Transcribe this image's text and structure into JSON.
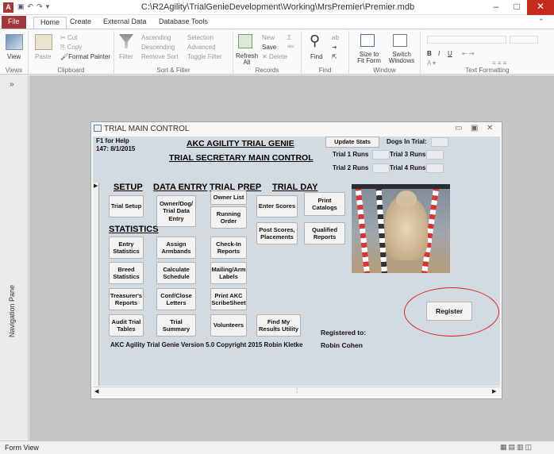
{
  "window": {
    "title": "C:\\R2Agility\\TrialGenieDevelopment\\Working\\MrsPremier\\Premier.mdb",
    "app_icon": "A"
  },
  "tabs": [
    "File",
    "Home",
    "Create",
    "External Data",
    "Database Tools"
  ],
  "ribbon": {
    "views": {
      "label": "View",
      "group": "Views"
    },
    "clipboard": {
      "paste": "Paste",
      "cut": "Cut",
      "copy": "Copy",
      "format_painter": "Format Painter",
      "group": "Clipboard"
    },
    "sort_filter": {
      "filter": "Filter",
      "ascending": "Ascending",
      "descending": "Descending",
      "remove_sort": "Remove Sort",
      "selection": "Selection",
      "advanced": "Advanced",
      "toggle_filter": "Toggle Filter",
      "group": "Sort & Filter"
    },
    "records": {
      "refresh": "Refresh All",
      "new": "New",
      "save": "Save",
      "delete": "Delete",
      "group": "Records"
    },
    "find": {
      "find": "Find",
      "group": "Find"
    },
    "window": {
      "size_to_fit": "Size to Fit Form",
      "switch_windows": "Switch Windows",
      "group": "Window"
    },
    "text_formatting": {
      "group": "Text Formatting"
    }
  },
  "nav_pane": "Navigation Pane",
  "status": "Form View",
  "form": {
    "title": "TRIAL MAIN CONTROL",
    "help": "F1 for Help",
    "version_line": "147: 8/1/2015",
    "heading1": "AKC AGILITY TRIAL GENIE",
    "heading2": "TRIAL SECRETARY MAIN CONTROL",
    "update_stats": "Update Stats",
    "dogs_in_trial": "Dogs In Trial:",
    "trial1": "Trial 1 Runs",
    "trial2": "Trial 2 Runs",
    "trial3": "Trial 3 Runs",
    "trial4": "Trial 4 Runs",
    "sections": {
      "setup": "SETUP",
      "data_entry": "DATA ENTRY",
      "trial_prep": "TRIAL PREP",
      "trial_day": "TRIAL DAY",
      "statistics": "STATISTICS"
    },
    "buttons": {
      "trial_setup": "Trial Setup",
      "owner_dog": "Owner/Dog/ Trial Data Entry",
      "owner_list": "Owner List",
      "running_order": "Running Order",
      "enter_scores": "Enter Scores",
      "print_catalogs": "Print Catalogs",
      "entry_stats": "Entry Statistics",
      "assign_armbands": "Assign Armbands",
      "checkin": "Check-In Reports",
      "post_scores": "Post Scores, Placements",
      "qualified": "Qualified Reports",
      "breed_stats": "Breed Statistics",
      "calc_schedule": "Calculate Schedule",
      "mailing": "Mailing/Arm Labels",
      "treasurer": "Treasurer's Reports",
      "conf_close": "Conf/Close Letters",
      "print_akc": "Print AKC ScribeSheet",
      "audit": "Audit Trial Tables",
      "trial_summary": "Trial Summary",
      "volunteers": "Volunteers",
      "find_results": "Find My Results Utility",
      "register": "Register"
    },
    "copyright": "AKC Agility Trial Genie Version 5.0 Copyright 2015 Robin Kletke",
    "registered_to_label": "Registered to:",
    "registered_to": "Robin Cohen"
  },
  "colors": {
    "accent": "#a4373a",
    "form_bg": "#d2dae2",
    "highlight": "#e0212b"
  }
}
